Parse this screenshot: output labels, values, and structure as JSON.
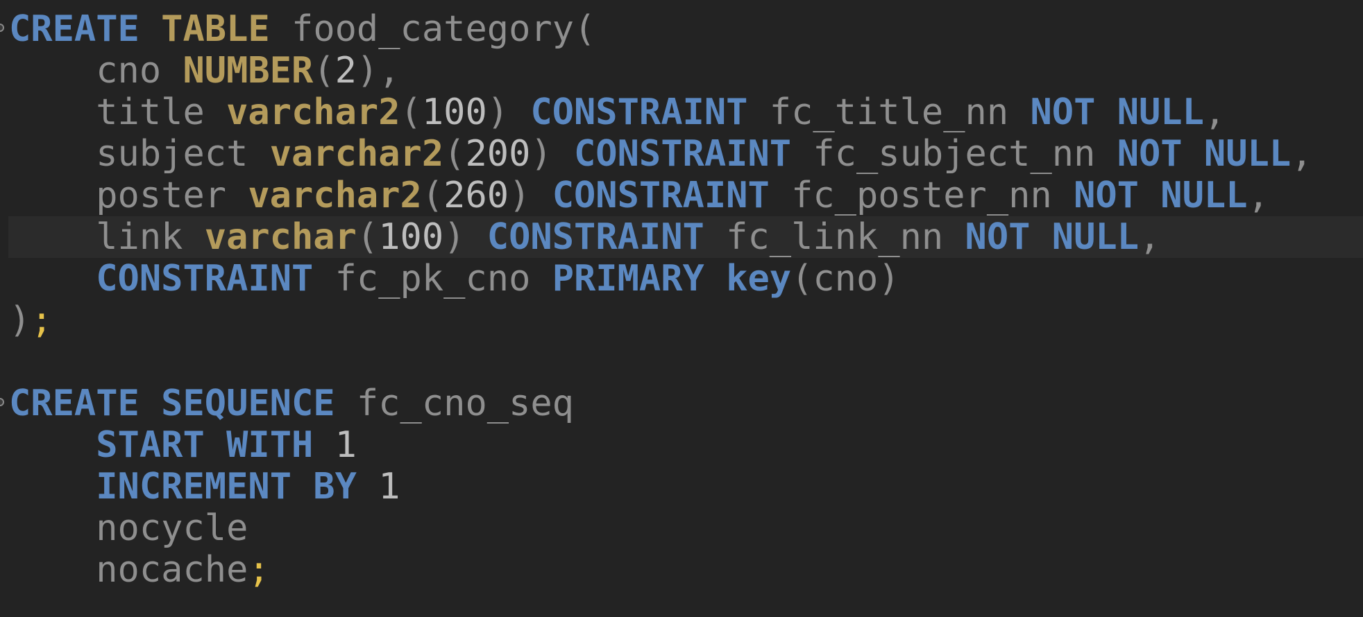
{
  "editor": {
    "current_line": 5,
    "colors": {
      "background": "#232323",
      "keyword": "#5b88c1",
      "type": "#b49b5b",
      "identifier": "#8f8f8f",
      "number": "#bdbdbd",
      "semicolon": "#e6c24a",
      "current_line": "#2b2b2b"
    },
    "fold_icon_lines": [
      0,
      9
    ],
    "lines": [
      [
        [
          "kw",
          "CREATE"
        ],
        [
          "id",
          " "
        ],
        [
          "type",
          "TABLE"
        ],
        [
          "id",
          " food_category"
        ],
        [
          "punc",
          "("
        ]
      ],
      [
        [
          "id",
          "    cno "
        ],
        [
          "type",
          "NUMBER"
        ],
        [
          "punc",
          "("
        ],
        [
          "num",
          "2"
        ],
        [
          "punc",
          "),"
        ]
      ],
      [
        [
          "id",
          "    title "
        ],
        [
          "type",
          "varchar2"
        ],
        [
          "punc",
          "("
        ],
        [
          "num",
          "100"
        ],
        [
          "punc",
          ") "
        ],
        [
          "kw",
          "CONSTRAINT"
        ],
        [
          "id",
          " fc_title_nn "
        ],
        [
          "kw",
          "NOT NULL"
        ],
        [
          "punc",
          ","
        ]
      ],
      [
        [
          "id",
          "    subject "
        ],
        [
          "type",
          "varchar2"
        ],
        [
          "punc",
          "("
        ],
        [
          "num",
          "200"
        ],
        [
          "punc",
          ") "
        ],
        [
          "kw",
          "CONSTRAINT"
        ],
        [
          "id",
          " fc_subject_nn "
        ],
        [
          "kw",
          "NOT NULL"
        ],
        [
          "punc",
          ","
        ]
      ],
      [
        [
          "id",
          "    poster "
        ],
        [
          "type",
          "varchar2"
        ],
        [
          "punc",
          "("
        ],
        [
          "num",
          "260"
        ],
        [
          "punc",
          ") "
        ],
        [
          "kw",
          "CONSTRAINT"
        ],
        [
          "id",
          " fc_poster_nn "
        ],
        [
          "kw",
          "NOT NULL"
        ],
        [
          "punc",
          ","
        ]
      ],
      [
        [
          "id",
          "    link "
        ],
        [
          "type",
          "varchar"
        ],
        [
          "punc",
          "("
        ],
        [
          "num",
          "100"
        ],
        [
          "punc",
          ") "
        ],
        [
          "kw",
          "CONSTRAINT"
        ],
        [
          "id",
          " fc_link_nn "
        ],
        [
          "kw",
          "NOT NULL"
        ],
        [
          "punc",
          ","
        ]
      ],
      [
        [
          "id",
          "    "
        ],
        [
          "kw",
          "CONSTRAINT"
        ],
        [
          "id",
          " fc_pk_cno "
        ],
        [
          "kw",
          "PRIMARY key"
        ],
        [
          "punc",
          "(cno)"
        ]
      ],
      [
        [
          "punc",
          ")"
        ],
        [
          "semi",
          ";"
        ]
      ],
      [],
      [
        [
          "kw",
          "CREATE SEQUENCE"
        ],
        [
          "id",
          " fc_cno_seq"
        ]
      ],
      [
        [
          "id",
          "    "
        ],
        [
          "kw",
          "START WITH"
        ],
        [
          "id",
          " "
        ],
        [
          "num",
          "1"
        ]
      ],
      [
        [
          "id",
          "    "
        ],
        [
          "kw",
          "INCREMENT BY"
        ],
        [
          "id",
          " "
        ],
        [
          "num",
          "1"
        ]
      ],
      [
        [
          "id",
          "    nocycle"
        ]
      ],
      [
        [
          "id",
          "    nocache"
        ],
        [
          "semi",
          ";"
        ]
      ]
    ]
  }
}
